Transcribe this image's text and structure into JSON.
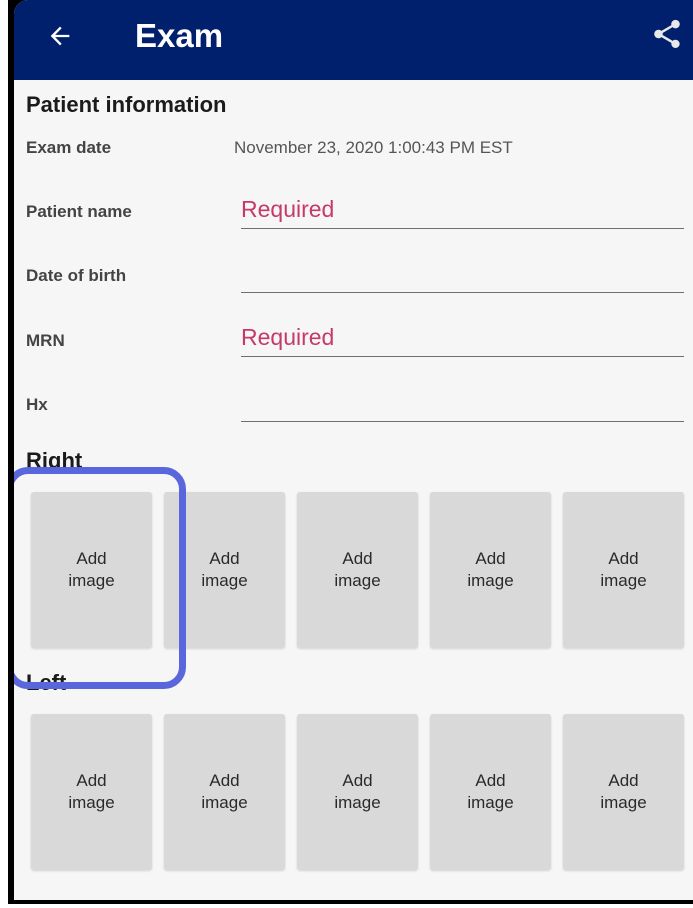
{
  "appbar": {
    "title": "Exam",
    "back_icon": "arrow-left-icon",
    "share_icon": "share-icon",
    "bg_color": "#00206e"
  },
  "patient_info": {
    "section_title": "Patient information",
    "exam_date": {
      "label": "Exam date",
      "value": "November 23, 2020 1:00:43 PM EST"
    },
    "patient_name": {
      "label": "Patient name",
      "value": "Required"
    },
    "date_of_birth": {
      "label": "Date of birth",
      "value": ""
    },
    "mrn": {
      "label": "MRN",
      "value": "Required"
    },
    "hx": {
      "label": "Hx",
      "value": ""
    }
  },
  "right": {
    "title": "Right",
    "tiles": [
      "Add image",
      "Add image",
      "Add image",
      "Add image",
      "Add image"
    ]
  },
  "left": {
    "title": "Left",
    "tiles": [
      "Add image",
      "Add image",
      "Add image",
      "Add image",
      "Add image"
    ]
  },
  "colors": {
    "required_text": "#c53a6a",
    "highlight": "#5a66dc",
    "tile_bg": "#d9d9d9"
  }
}
